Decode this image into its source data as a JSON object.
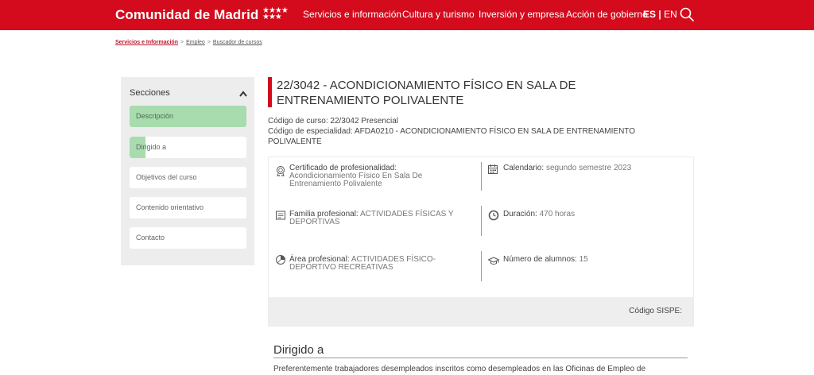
{
  "header": {
    "brand": "Comunidad de Madrid",
    "nav": [
      "Servicios e información",
      "Cultura y turismo",
      "Inversión y empresa",
      "Acción de gobierno"
    ],
    "lang_es": "ES",
    "lang_sep": "|",
    "lang_en": "EN",
    "brand_color": "#d30b1d"
  },
  "breadcrumb": [
    "Servicios e Información",
    "Empleo",
    "Buscador de cursos"
  ],
  "breadcrumb_sep": ">",
  "sidebar": {
    "title": "Secciones",
    "items": [
      "Descripción",
      "Dirigido a",
      "Objetivos del curso",
      "Contenido orientativo",
      "Contacto"
    ],
    "active_color": "#a8dcae"
  },
  "course": {
    "title": "22/3042 - ACONDICIONAMIENTO FÍSICO EN SALA DE ENTRENAMIENTO POLIVALENTE",
    "codigo_curso": "Código de curso: 22/3042 Presencial",
    "codigo_especialidad": "Código de especialidad: AFDA0210 - ACONDICIONAMIENTO FÍSICO EN SALA DE ENTRENAMIENTO POLIVALENTE"
  },
  "info": {
    "certificado_label": "Certificado de profesionalidad:",
    "certificado_value": "Acondicionamiento Físico En Sala De Entrenamiento Polivalente",
    "calendario_label": "Calendario:",
    "calendario_value": "segundo semestre 2023",
    "familia_label": "Familia profesional:",
    "familia_value": "ACTIVIDADES FÍSICAS Y DEPORTIVAS",
    "duracion_label": "Duración:",
    "duracion_value": "470 horas",
    "area_label": "Área profesional:",
    "area_value": "ACTIVIDADES FÍSICO-DEPORTIVO RECREATIVAS",
    "alumnos_label": "Número de alumnos:",
    "alumnos_value": "15",
    "sispe": "Código SISPE:"
  },
  "dirigido": {
    "heading": "Dirigido a",
    "text": "Preferentemente trabajadores desempleados inscritos como desempleados en las Oficinas de Empleo de"
  }
}
